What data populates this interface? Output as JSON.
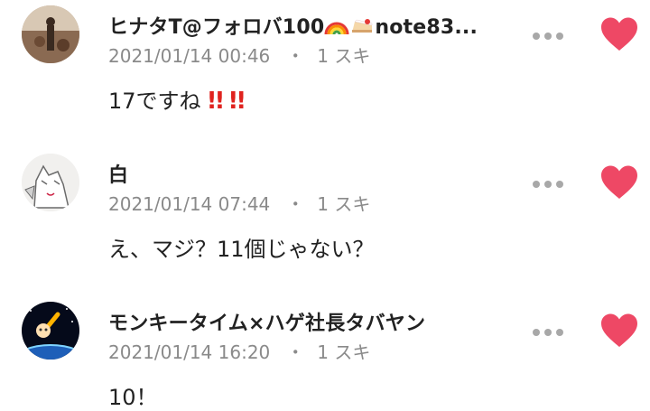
{
  "comments": [
    {
      "author": "ヒナタT@フォロバ100",
      "author_suffix": "note83...",
      "author_emojis": [
        "rainbow-icon",
        "cake-icon"
      ],
      "timestamp": "2021/01/14 00:46",
      "separator": "・",
      "likes": "1 スキ",
      "text": "17ですね",
      "text_emojis": [
        "double-exclamation-icon",
        "double-exclamation-icon"
      ],
      "liked": true
    },
    {
      "author": "白",
      "timestamp": "2021/01/14 07:44",
      "separator": "・",
      "likes": "1 スキ",
      "text": "え、マジ？11個じゃない？",
      "liked": true
    },
    {
      "author": "モンキータイム×ハゲ社長タバヤン",
      "timestamp": "2021/01/14 16:20",
      "separator": "・",
      "likes": "1 スキ",
      "text": "10！",
      "liked": true
    }
  ],
  "colors": {
    "heart": "#ee4865",
    "muted_text": "#8a8a8a",
    "dots": "#a8a8a8"
  }
}
